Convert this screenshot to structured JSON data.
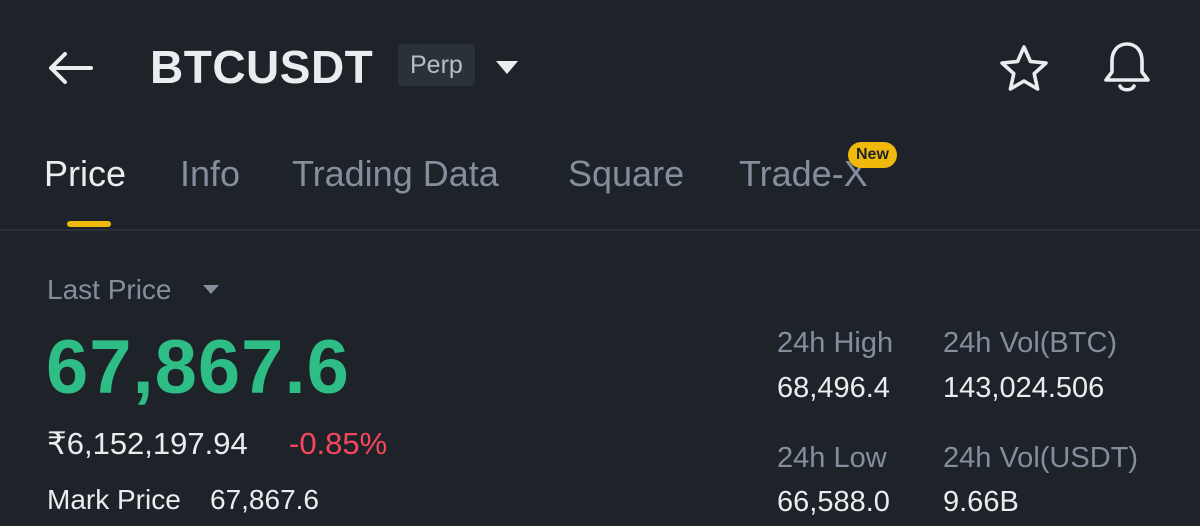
{
  "header": {
    "title": "BTCUSDT",
    "badge": "Perp",
    "icons": {
      "back": "arrow-left-icon",
      "dropdown": "caret-down-icon",
      "favorite": "star-icon",
      "alert": "bell-icon"
    }
  },
  "tabs": [
    {
      "label": "Price",
      "active": true
    },
    {
      "label": "Info",
      "active": false
    },
    {
      "label": "Trading Data",
      "active": false
    },
    {
      "label": "Square",
      "active": false
    },
    {
      "label": "Trade-X",
      "active": false,
      "badge": "New"
    }
  ],
  "price": {
    "last_price_label": "Last Price",
    "last_price": "67,867.6",
    "fiat_price": "₹6,152,197.94",
    "change_pct": "-0.85%",
    "mark_price_label": "Mark Price",
    "mark_price": "67,867.6"
  },
  "stats": {
    "high_label": "24h High",
    "high_value": "68,496.4",
    "vol_btc_label": "24h Vol(BTC)",
    "vol_btc_value": "143,024.506",
    "low_label": "24h Low",
    "low_value": "66,588.0",
    "vol_usdt_label": "24h Vol(USDT)",
    "vol_usdt_value": "9.66B"
  },
  "colors": {
    "background": "#1e2329",
    "accent": "#f0b90b",
    "up": "#2ebd85",
    "down": "#f6465d",
    "muted": "#848e9c"
  }
}
